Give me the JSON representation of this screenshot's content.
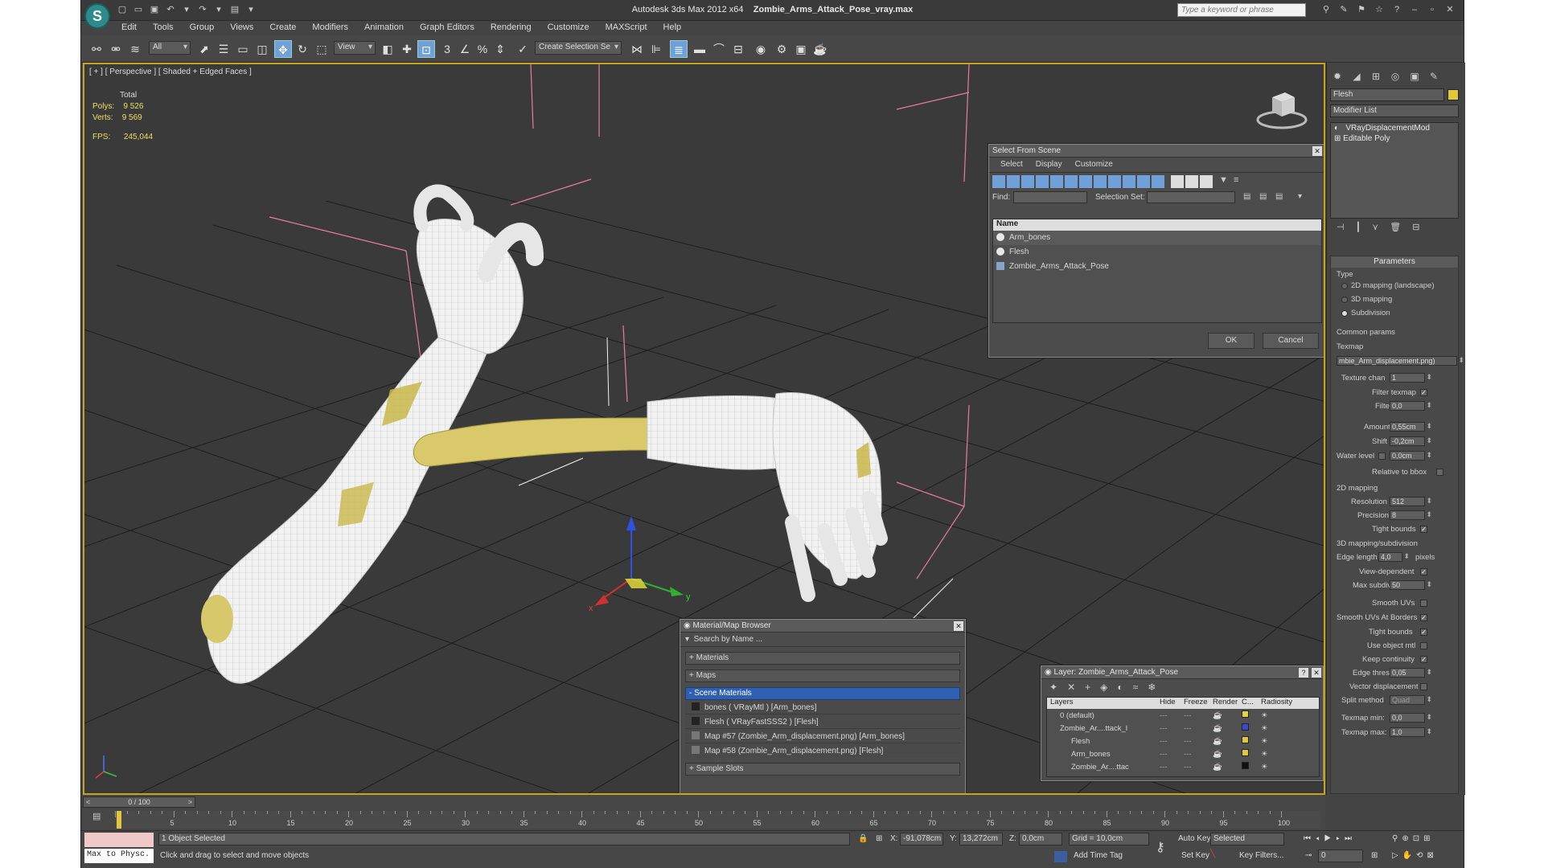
{
  "app": {
    "title_app": "Autodesk 3ds Max  2012 x64",
    "title_file": "Zombie_Arms_Attack_Pose_vray.max",
    "search_placeholder": "Type a keyword or phrase",
    "logo_glyph": "S"
  },
  "menu": [
    "Edit",
    "Tools",
    "Group",
    "Views",
    "Create",
    "Modifiers",
    "Animation",
    "Graph Editors",
    "Rendering",
    "Customize",
    "MAXScript",
    "Help"
  ],
  "toolbar": {
    "filter_value": "All",
    "ref_coord_value": "View",
    "selection_set_placeholder": "Create Selection Se",
    "snap_label": "3",
    "angle_snap_label": "%"
  },
  "viewport": {
    "label": "[ + ] [ Perspective ] [ Shaded + Edged Faces ]",
    "stats_header": "Total",
    "polys_label": "Polys:",
    "polys_value": "9 526",
    "verts_label": "Verts:",
    "verts_value": "9 569",
    "fps_label": "FPS:",
    "fps_value": "245,044",
    "gizmo_x": "x",
    "gizmo_y": "y",
    "gizmo_z": "z"
  },
  "select_dialog": {
    "title": "Select From Scene",
    "menu": [
      "Select",
      "Display",
      "Customize"
    ],
    "find_label": "Find:",
    "selection_set_label": "Selection Set:",
    "column_name": "Name",
    "items": [
      "Arm_bones",
      "Flesh",
      "Zombie_Arms_Attack_Pose"
    ],
    "ok": "OK",
    "cancel": "Cancel"
  },
  "material_browser": {
    "title": "Material/Map Browser",
    "search_placeholder": "Search by Name ...",
    "sections": [
      "+ Materials",
      "+ Maps"
    ],
    "scene_materials": "- Scene Materials",
    "items": [
      "bones  ( VRayMtl ) [Arm_bones]",
      "Flesh  ( VRayFastSSS2 ) [Flesh]",
      "Map #57 (Zombie_Arm_displacement.png) [Arm_bones]",
      "Map #58 (Zombie_Arm_displacement.png) [Flesh]"
    ],
    "sample_slots": "+ Sample Slots"
  },
  "layer_dialog": {
    "title": "Layer: Zombie_Arms_Attack_Pose",
    "help": "?",
    "columns": [
      "Layers",
      "Hide",
      "Freeze",
      "Render",
      "C...",
      "Radiosity"
    ],
    "rows": [
      {
        "name": "0 (default)",
        "color": "#e3d63a"
      },
      {
        "name": "Zombie_Ar....ttack_l",
        "color": "#3a4ad0"
      },
      {
        "name": "Flesh",
        "color": "#e3c73a"
      },
      {
        "name": "Arm_bones",
        "color": "#e3c73a"
      },
      {
        "name": "Zombie_Ar....ttac",
        "color": "#111111"
      }
    ]
  },
  "command_panel": {
    "object_name": "Flesh",
    "modifier_list": "Modifier List",
    "stack": [
      "VRayDisplacementMod",
      "Editable Poly"
    ],
    "rollout_title": "Parameters",
    "type_label": "Type",
    "type_options": [
      "2D mapping (landscape)",
      "3D mapping",
      "Subdivision"
    ],
    "common_params": "Common params",
    "texmap_label": "Texmap",
    "texmap_value": "mbie_Arm_displacement.png)",
    "texture_chan_label": "Texture chan",
    "texture_chan_value": "1",
    "filter_texmap_label": "Filter texmap",
    "filter_blur_label": "Filter blur",
    "filter_blur_value": "0,0",
    "amount_label": "Amount",
    "amount_value": "0,55cm",
    "shift_label": "Shift",
    "shift_value": "-0,2cm",
    "water_level_label": "Water level",
    "water_level_value": "0,0cm",
    "relative_bbox_label": "Relative to bbox",
    "mapping2d_label": "2D mapping",
    "resolution_label": "Resolution",
    "resolution_value": "512",
    "precision_label": "Precision",
    "precision_value": "8",
    "tight_bounds_label": "Tight bounds",
    "mapping3d_label": "3D mapping/subdivision",
    "edge_length_label": "Edge length",
    "edge_length_value": "4,0",
    "pixels_label": "pixels",
    "view_dependent_label": "View-dependent",
    "max_subdivs_label": "Max subdivs",
    "max_subdivs_value": "50",
    "smooth_uvs_label": "Smooth UVs",
    "smooth_uvs_borders_label": "Smooth UVs At Borders",
    "tight_bounds2_label": "Tight bounds",
    "use_object_mtl_label": "Use object mtl",
    "keep_continuity_label": "Keep continuity",
    "edge_thresh_label": "Edge thresh",
    "edge_thresh_value": "0,05",
    "vector_disp_label": "Vector displacement",
    "split_method_label": "Split method",
    "split_method_value": "Quad",
    "texmap_min_label": "Texmap min:",
    "texmap_min_value": "0,0",
    "texmap_max_label": "Texmap max:",
    "texmap_max_value": "1,0"
  },
  "timeline": {
    "slider": "0 / 100",
    "ticks": [
      "5",
      "10",
      "15",
      "20",
      "25",
      "30",
      "35",
      "40",
      "45",
      "50",
      "55",
      "60",
      "65",
      "70",
      "75",
      "80",
      "85",
      "90",
      "95",
      "100"
    ]
  },
  "status": {
    "maxscript": "Max to Physc.",
    "selection": "1 Object Selected",
    "prompt": "Click and drag to select and move objects",
    "x_label": "X:",
    "x_value": "-91,078cm",
    "y_label": "Y:",
    "y_value": "13,272cm",
    "z_label": "Z:",
    "z_value": "0,0cm",
    "grid": "Grid = 10,0cm",
    "add_time_tag": "Add Time Tag",
    "auto_key": "Auto Key",
    "set_key": "Set Key",
    "selected_value": "Selected",
    "key_filters": "Key Filters...",
    "frame_value": "0"
  }
}
